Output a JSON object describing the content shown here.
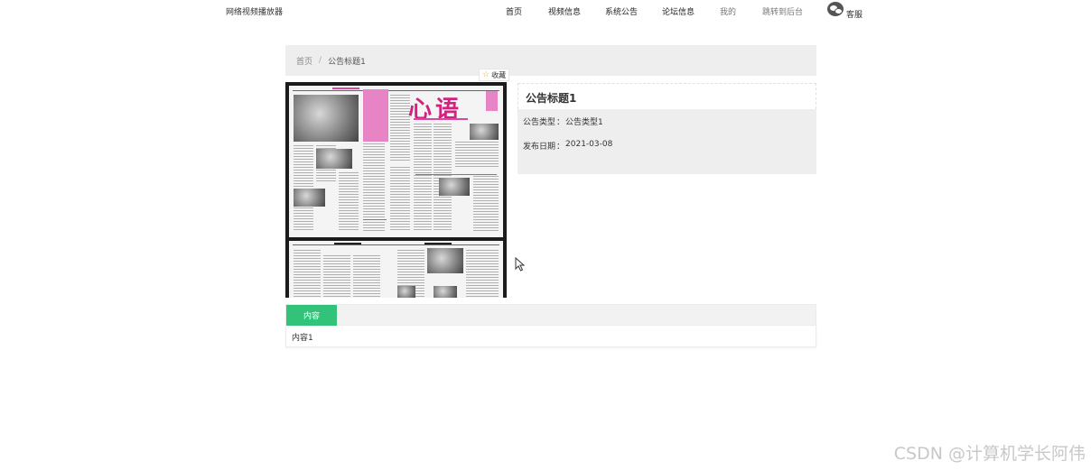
{
  "site": {
    "title": "网络视频播放器"
  },
  "nav": {
    "items": [
      {
        "label": "首页"
      },
      {
        "label": "视频信息"
      },
      {
        "label": "系统公告"
      },
      {
        "label": "论坛信息"
      },
      {
        "label": "我的"
      },
      {
        "label": "跳转到后台"
      }
    ],
    "service_label": "客服"
  },
  "breadcrumb": {
    "home": "首页",
    "separator": "/",
    "current": "公告标题1"
  },
  "favorite": {
    "label": "收藏",
    "icon": "star-icon"
  },
  "notice": {
    "title": "公告标题1",
    "type_label": "公告类型",
    "type_value": "公告类型1",
    "date_label": "发布日期",
    "date_value": "2021-03-08",
    "colon": "："
  },
  "tabs": {
    "content_label": "内容"
  },
  "content": {
    "text": "内容1"
  },
  "watermark": "CSDN @计算机学长阿伟",
  "colors": {
    "accent_green": "#33c27a",
    "panel_gray": "#eeeeef",
    "star": "#f0a800"
  }
}
